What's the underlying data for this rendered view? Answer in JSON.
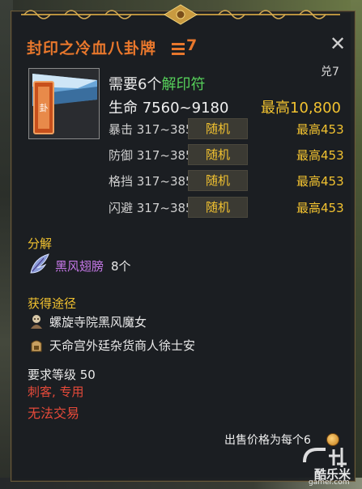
{
  "tooltip": {
    "title": "封印之冷血八卦牌",
    "enhance_level": "7",
    "trigram": "兑7",
    "requirement": {
      "prefix": "需要6个",
      "highlight": "解印符"
    },
    "hp": {
      "label": "生命 7560~9180",
      "max": "最高10,800"
    },
    "stats": [
      {
        "name": "暴击 317~385",
        "random": "随机",
        "max": "最高453"
      },
      {
        "name": "防御 317~385",
        "random": "随机",
        "max": "最高453"
      },
      {
        "name": "格挡 317~385",
        "random": "随机",
        "max": "最高453"
      },
      {
        "name": "闪避 317~385",
        "random": "随机",
        "max": "最高453"
      }
    ],
    "decompose": {
      "title": "分解",
      "item": "黑风翅膀",
      "qty": "8个"
    },
    "sources": {
      "title": "获得途径",
      "items": [
        {
          "icon": "monster-icon",
          "text": "螺旋寺院黑风魔女"
        },
        {
          "icon": "merchant-icon",
          "text": "天命宫外廷杂货商人徐士安"
        }
      ]
    },
    "level_req": "要求等级 50",
    "class_req": "刺客, 专用",
    "trade": "无法交易",
    "sell_price": "出售价格为每个6"
  },
  "watermark": {
    "logo": "酷乐米",
    "url": "gamer.com"
  },
  "colors": {
    "title": "#e8772c",
    "gold": "#f2c230",
    "green": "#56d05a",
    "purple": "#c678e8",
    "red": "#e64a3a"
  }
}
